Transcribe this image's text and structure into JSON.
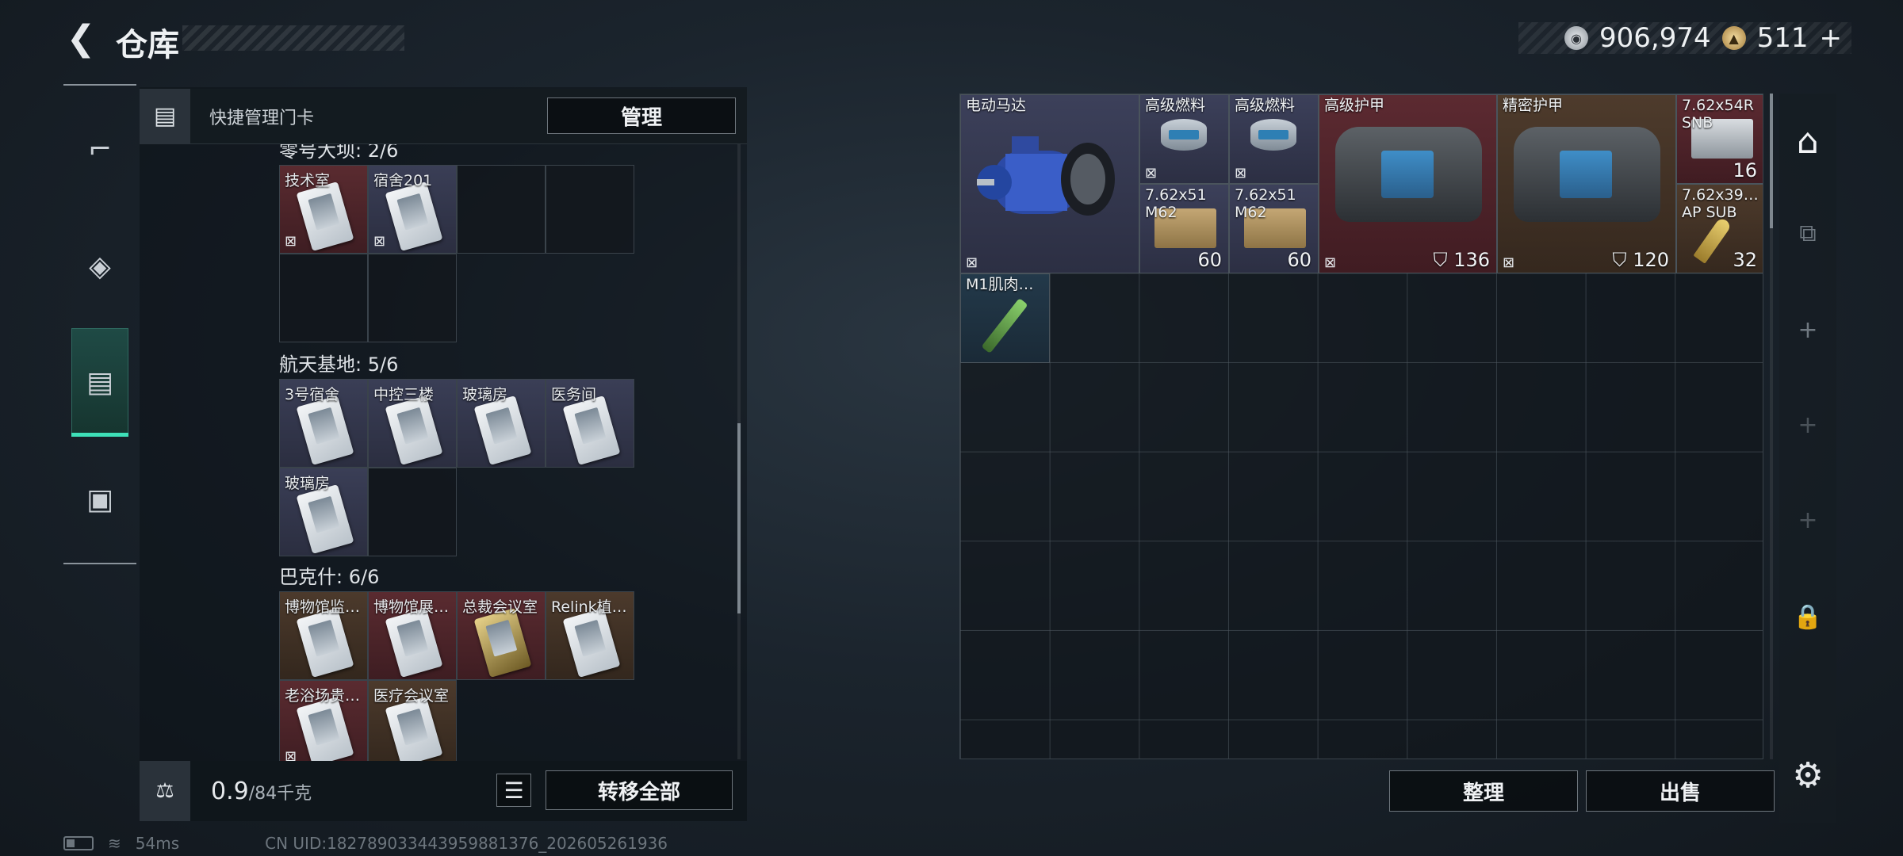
{
  "header": {
    "title": "仓库",
    "back_icon": "back-arrow-icon",
    "silver_amount": "906,974",
    "gold_amount": "511",
    "gold_plus": "+"
  },
  "side_tabs": [
    {
      "icon": "gun-icon"
    },
    {
      "icon": "backpack-icon"
    },
    {
      "icon": "keycard-holder-icon",
      "active": true
    },
    {
      "icon": "toolbox-icon"
    }
  ],
  "keycard_panel": {
    "header_label": "快捷管理门卡",
    "manage_label": "管理",
    "groups": [
      {
        "title": "零号大坝: 2/6",
        "cards": [
          {
            "label": "技术室",
            "color": "red",
            "nobind": true
          },
          {
            "label": "宿舍201",
            "color": "grey",
            "nobind": true
          }
        ]
      },
      {
        "title": "航天基地: 5/6",
        "cards": [
          {
            "label": "3号宿舍",
            "color": "grey"
          },
          {
            "label": "中控三楼",
            "color": "grey"
          },
          {
            "label": "玻璃房",
            "color": "grey"
          },
          {
            "label": "医务间",
            "color": "grey"
          },
          {
            "label": "玻璃房",
            "color": "grey"
          }
        ]
      },
      {
        "title": "巴克什: 6/6",
        "cards": [
          {
            "label": "博物馆监…",
            "color": "brown"
          },
          {
            "label": "博物馆展…",
            "color": "red"
          },
          {
            "label": "总裁会议室",
            "color": "red"
          },
          {
            "label": "Relink植…",
            "color": "brown"
          },
          {
            "label": "老浴场贵…",
            "color": "red"
          },
          {
            "label": "医疗会议室",
            "color": "brown"
          }
        ]
      }
    ],
    "weight_value": "0.9",
    "weight_max": "/84千克",
    "transfer_all_label": "转移全部"
  },
  "storage": {
    "items": [
      {
        "name": "电动马达",
        "color": "grey",
        "nobind": true
      },
      {
        "name": "高级燃料",
        "color": "grey",
        "nobind": true
      },
      {
        "name": "高级燃料",
        "color": "grey",
        "nobind": true
      },
      {
        "name": "7.62x51\nM62",
        "color": "grey",
        "count": "60"
      },
      {
        "name": "7.62x51\nM62",
        "color": "grey",
        "count": "60"
      },
      {
        "name": "高级护甲",
        "color": "red",
        "nobind": true,
        "durability": "136"
      },
      {
        "name": "精密护甲",
        "color": "brown",
        "nobind": true,
        "durability": "120"
      },
      {
        "name": "7.62x54R\nSNB",
        "color": "red",
        "count": "16"
      },
      {
        "name": "7.62x39…\nAP SUB",
        "color": "brown",
        "count": "32"
      },
      {
        "name": "M1肌肉…",
        "color": "teal"
      }
    ],
    "sort_label": "整理",
    "sell_label": "出售"
  },
  "status": {
    "ping": "54ms",
    "uid": "CN UID:182789033443959881376_202605261936"
  }
}
